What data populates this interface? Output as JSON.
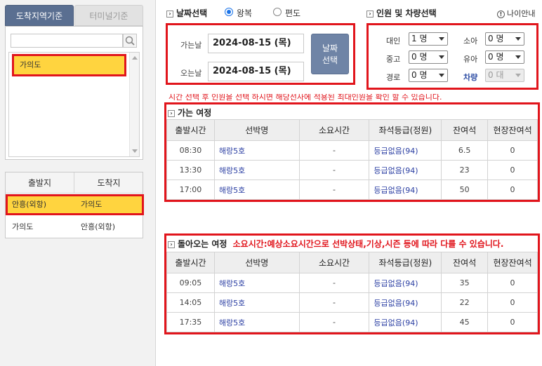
{
  "sidebar": {
    "tabs": [
      {
        "label": "도착지역기준",
        "active": true
      },
      {
        "label": "터미널기준",
        "active": false
      }
    ],
    "search": {
      "placeholder": "",
      "value": ""
    },
    "regions": [
      "가의도"
    ],
    "route_headers": {
      "departure": "출발지",
      "arrival": "도착지"
    },
    "routes": [
      {
        "departure": "안흥(외항)",
        "arrival": "가의도",
        "selected": true
      },
      {
        "departure": "가의도",
        "arrival": "안흥(외항)",
        "selected": false
      }
    ]
  },
  "date_section": {
    "title": "날짜선택",
    "trip_options": [
      {
        "label": "왕복",
        "selected": true
      },
      {
        "label": "편도",
        "selected": false
      }
    ],
    "go_label": "가는날",
    "go_value": "2024-08-15 (목)",
    "return_label": "오는날",
    "return_value": "2024-08-15 (목)",
    "button_label_line1": "날짜",
    "button_label_line2": "선택"
  },
  "pax_section": {
    "title": "인원 및 차량선택",
    "age_info_label": "나이안내",
    "fields": [
      {
        "label": "대인",
        "value": "1 명"
      },
      {
        "label": "소아",
        "value": "0 명"
      },
      {
        "label": "중고",
        "value": "0 명"
      },
      {
        "label": "유아",
        "value": "0 명"
      },
      {
        "label": "경로",
        "value": "0 명"
      },
      {
        "label": "차량",
        "value": "0 대",
        "disabled": true
      }
    ]
  },
  "notice": "시간 선택 후 인원을 선택 하시면 해당선사에 적용된 최대인원을 확인 할 수 있습니다.",
  "columns": [
    "출발시간",
    "선박명",
    "소요시간",
    "좌석등급(정원)",
    "잔여석",
    "현장잔여석"
  ],
  "outbound": {
    "title": "가는 여정",
    "rows": [
      {
        "time": "08:30",
        "ship": "해랑5호",
        "duration": "-",
        "grade": "등급없음(94)",
        "seats": "6.5",
        "onsite": "0"
      },
      {
        "time": "13:30",
        "ship": "해랑5호",
        "duration": "-",
        "grade": "등급없음(94)",
        "seats": "23",
        "onsite": "0"
      },
      {
        "time": "17:00",
        "ship": "해랑5호",
        "duration": "-",
        "grade": "등급없음(94)",
        "seats": "50",
        "onsite": "0"
      }
    ]
  },
  "inbound": {
    "title": "돌아오는 여정",
    "note": "소요시간:예상소요시간으로 선박상태,기상,시즌 등에 따라 다를 수 있습니다.",
    "rows": [
      {
        "time": "09:05",
        "ship": "해랑5호",
        "duration": "-",
        "grade": "등급없음(94)",
        "seats": "35",
        "onsite": "0"
      },
      {
        "time": "14:05",
        "ship": "해랑5호",
        "duration": "-",
        "grade": "등급없음(94)",
        "seats": "22",
        "onsite": "0"
      },
      {
        "time": "17:35",
        "ship": "해랑5호",
        "duration": "-",
        "grade": "등급없음(94)",
        "seats": "45",
        "onsite": "0"
      }
    ]
  },
  "colors": {
    "highlight_border": "#e1151c",
    "selected_fill": "#ffd43f",
    "tab_active": "#5a6f91",
    "link": "#2b3fa3"
  }
}
